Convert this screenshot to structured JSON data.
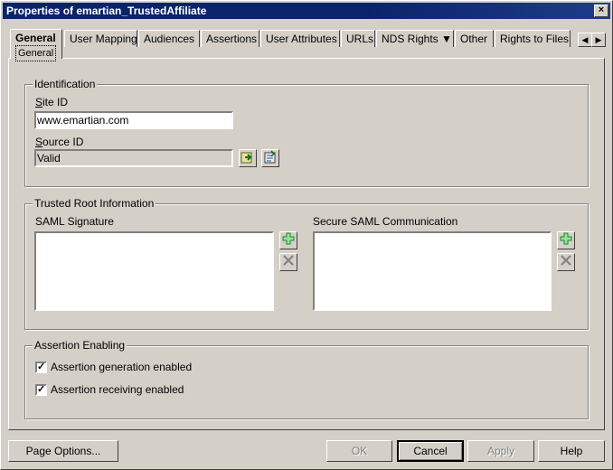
{
  "window": {
    "title": "Properties of emartian_TrustedAffiliate",
    "close_glyph": "×"
  },
  "tabs": {
    "items": [
      {
        "label": "General",
        "sub": "General"
      },
      {
        "label": "User Mapping"
      },
      {
        "label": "Audiences"
      },
      {
        "label": "Assertions"
      },
      {
        "label": "User Attributes"
      },
      {
        "label": "URLs"
      },
      {
        "label": "NDS Rights ▼"
      },
      {
        "label": "Other"
      },
      {
        "label": "Rights to Files &"
      }
    ],
    "scroll_left": "◀",
    "scroll_right": "▶"
  },
  "identification": {
    "legend": "Identification",
    "site_id_label": "Site ID",
    "site_id_value": "www.emartian.com",
    "source_id_label": "Source ID",
    "source_id_value": "Valid"
  },
  "trusted_root": {
    "legend": "Trusted Root Information",
    "saml_signature_label": "SAML Signature",
    "secure_saml_label": "Secure SAML Communication"
  },
  "assertion": {
    "legend": "Assertion Enabling",
    "generation_label": "Assertion generation enabled",
    "generation_checked": true,
    "receiving_label": "Assertion receiving enabled",
    "receiving_checked": true
  },
  "buttons": {
    "page_options": "Page Options...",
    "ok": "OK",
    "cancel": "Cancel",
    "apply": "Apply",
    "help": "Help"
  },
  "colors": {
    "titlebar": "#0a246a",
    "face": "#d4d0c8",
    "add_icon": "#1a8a2a"
  }
}
